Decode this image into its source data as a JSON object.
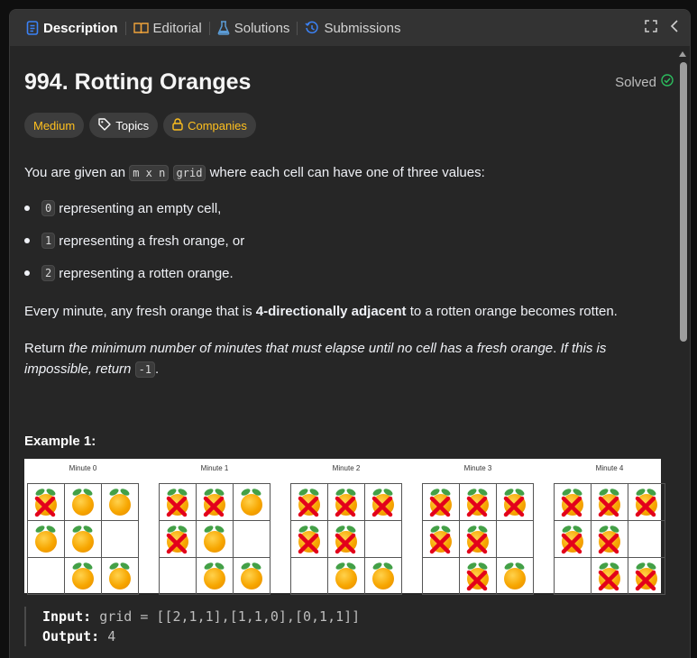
{
  "tabs": [
    {
      "label": "Description",
      "icon": "description-icon",
      "active": true
    },
    {
      "label": "Editorial",
      "icon": "book-icon"
    },
    {
      "label": "Solutions",
      "icon": "flask-icon"
    },
    {
      "label": "Submissions",
      "icon": "history-icon"
    }
  ],
  "problem": {
    "title": "994. Rotting Oranges",
    "status": "Solved",
    "difficulty": "Medium",
    "topics_label": "Topics",
    "companies_label": "Companies"
  },
  "description": {
    "intro_before": "You are given an ",
    "intro_code1": "m x n",
    "intro_code2": "grid",
    "intro_after": " where each cell can have one of three values:",
    "bullets": [
      {
        "code": "0",
        "text": "representing an empty cell,"
      },
      {
        "code": "1",
        "text": "representing a fresh orange, or"
      },
      {
        "code": "2",
        "text": "representing a rotten orange."
      }
    ],
    "rule_before": "Every minute, any fresh orange that is ",
    "rule_bold": "4-directionally adjacent",
    "rule_after": " to a rotten orange becomes rotten.",
    "return_before": "Return ",
    "return_italic": "the minimum number of minutes that must elapse until no cell has a fresh orange",
    "return_mid": ". ",
    "return_italic2": "If this is impossible, return",
    "return_code": "-1",
    "return_end": "."
  },
  "example": {
    "heading": "Example 1:",
    "minute_labels": [
      "Minute 0",
      "Minute 1",
      "Minute 2",
      "Minute 3",
      "Minute 4"
    ],
    "grids": [
      [
        [
          2,
          1,
          1
        ],
        [
          1,
          1,
          0
        ],
        [
          0,
          1,
          1
        ]
      ],
      [
        [
          2,
          2,
          1
        ],
        [
          2,
          1,
          0
        ],
        [
          0,
          1,
          1
        ]
      ],
      [
        [
          2,
          2,
          2
        ],
        [
          2,
          2,
          0
        ],
        [
          0,
          1,
          1
        ]
      ],
      [
        [
          2,
          2,
          2
        ],
        [
          2,
          2,
          0
        ],
        [
          0,
          2,
          1
        ]
      ],
      [
        [
          2,
          2,
          2
        ],
        [
          2,
          2,
          0
        ],
        [
          0,
          2,
          2
        ]
      ]
    ],
    "input_label": "Input:",
    "input_value": "grid = [[2,1,1],[1,1,0],[0,1,1]]",
    "output_label": "Output:",
    "output_value": "4"
  },
  "colors": {
    "accent_medium": "#ffc01e",
    "solved_check": "#2cbb5d",
    "tab_icon_blue": "#3b82f6",
    "flask_icon": "#5b9bd5"
  }
}
